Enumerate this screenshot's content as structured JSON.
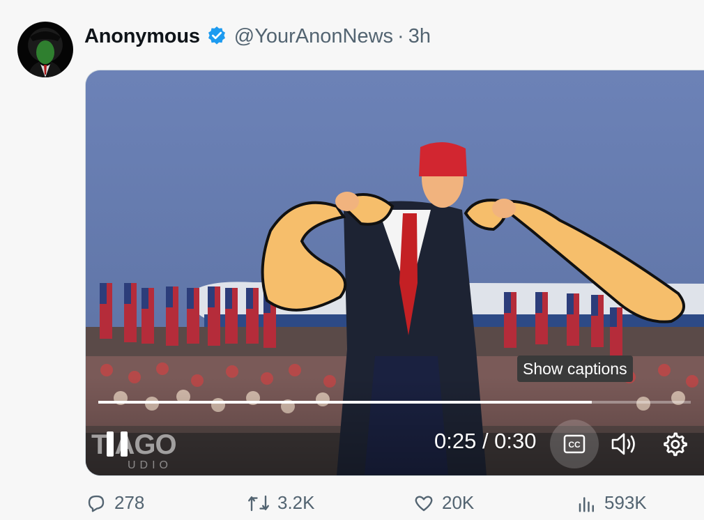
{
  "post": {
    "author_name": "Anonymous",
    "handle": "@YourAnonNews",
    "separator": "·",
    "time": "3h",
    "verified": true
  },
  "video": {
    "tooltip": "Show captions",
    "current_time": "0:25",
    "duration": "0:30",
    "time_display": "0:25 / 0:30",
    "progress_fraction": 0.833,
    "watermark": "TIAGO",
    "watermark_sub": "UDIO",
    "icons": [
      "pause-icon",
      "captions-icon",
      "volume-icon",
      "settings-gear-icon"
    ]
  },
  "actions": {
    "replies": "278",
    "reposts": "3.2K",
    "likes": "20K",
    "views": "593K"
  },
  "colors": {
    "verified_blue": "#1d9bf0",
    "secondary_text": "#536471",
    "accent_orange": "#f6be6b"
  }
}
